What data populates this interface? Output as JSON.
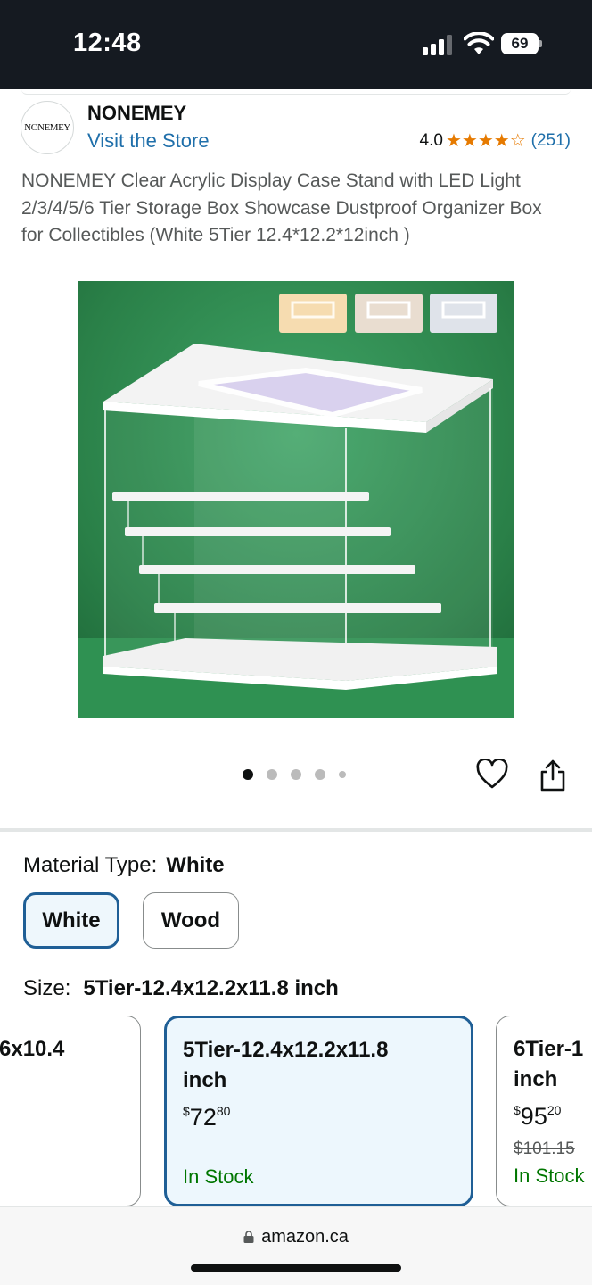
{
  "status_bar": {
    "time": "12:48",
    "battery": "69"
  },
  "brand": {
    "logo_text": "NONEMEY",
    "name": "NONEMEY",
    "visit_store": "Visit the Store"
  },
  "rating": {
    "value": "4.0",
    "stars": 4,
    "review_count": "(251)"
  },
  "product": {
    "title": "NONEMEY Clear Acrylic Display Case Stand with LED Light 2/3/4/5/6 Tier Storage Box Showcase Dustproof Organizer Box for Collectibles (White 5Tier 12.4*12.2*12inch )",
    "image_count": 5,
    "active_image_index": 0
  },
  "material": {
    "label": "Material Type:",
    "selected": "White",
    "options": [
      "White",
      "Wood"
    ]
  },
  "size": {
    "label": "Size:",
    "selected": "5Tier-12.4x12.2x11.8 inch",
    "cards": [
      {
        "name": "6x10.4",
        "price": "",
        "old_price": "",
        "stock": ""
      },
      {
        "name_line1": "5Tier-12.4x12.2x11.8",
        "name_line2": "inch",
        "price_symbol": "$",
        "price_whole": "72",
        "price_cents": "80",
        "stock": "In Stock"
      },
      {
        "name_line1": "6Tier-1",
        "name_line2": "inch",
        "price_symbol": "$",
        "price_whole": "95",
        "price_cents": "20",
        "old_price": "$101.15",
        "stock": "In Stock"
      }
    ]
  },
  "browser": {
    "url": "amazon.ca"
  },
  "colors": {
    "link": "#1f6faa",
    "star": "#e67a00",
    "in_stock": "#007600",
    "selected_border": "#1f5f96"
  }
}
